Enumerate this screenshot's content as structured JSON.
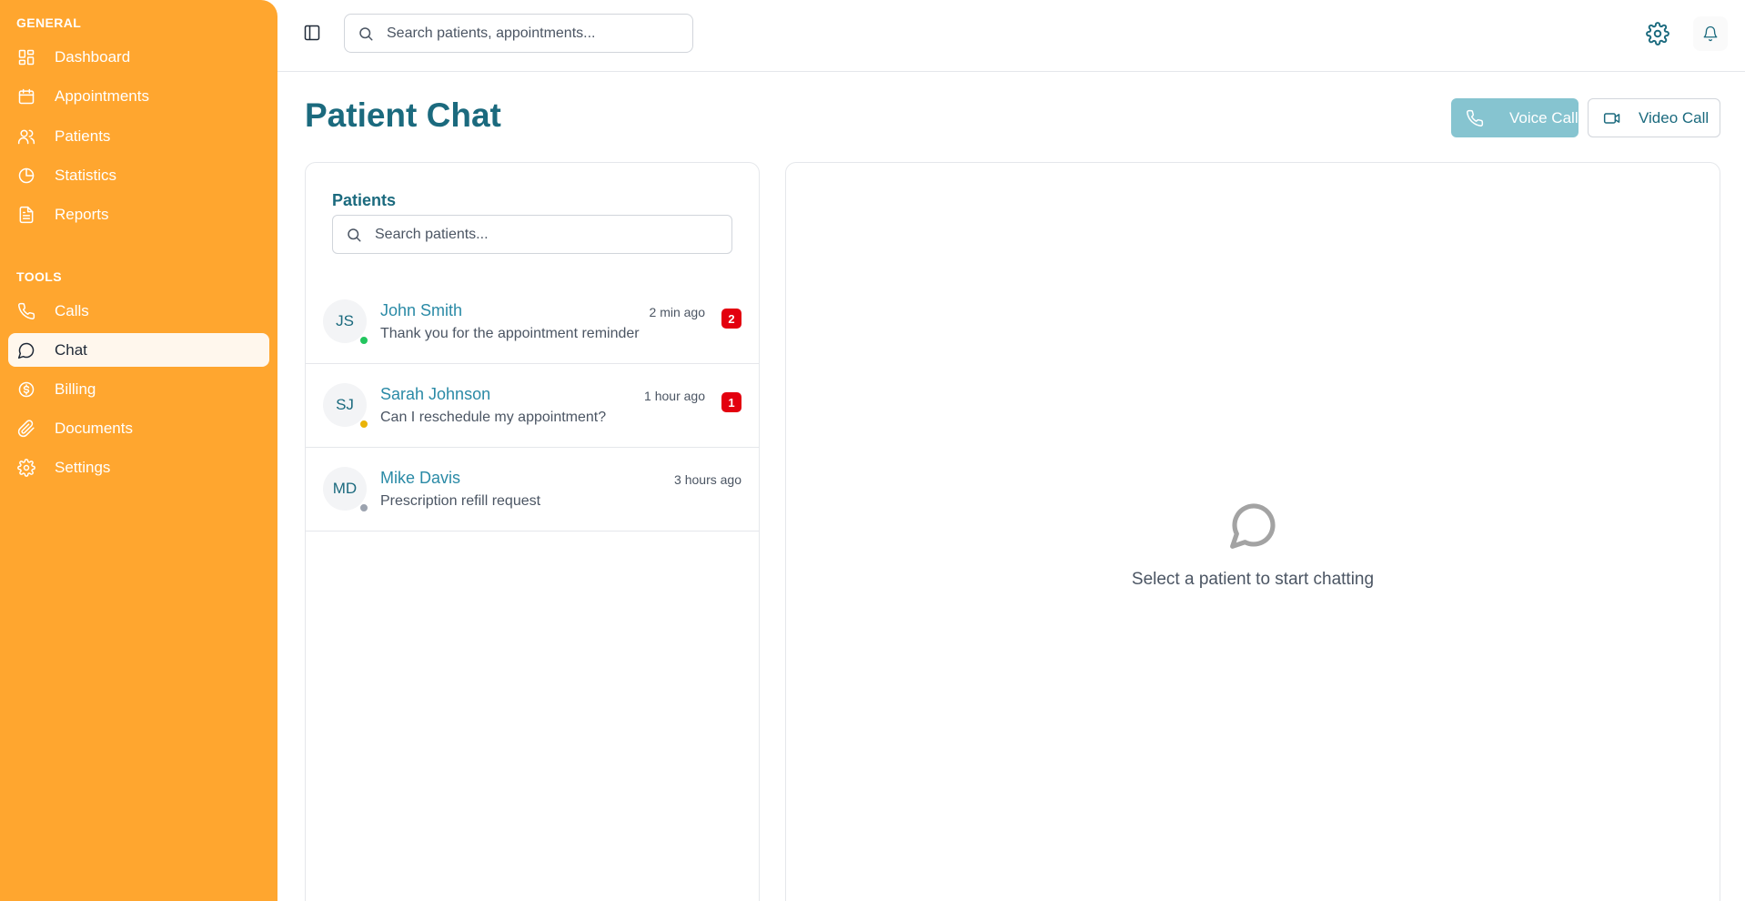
{
  "sidebar": {
    "general_label": "GENERAL",
    "tools_label": "TOOLS",
    "general_items": [
      {
        "label": "Dashboard",
        "icon": "dashboard-icon"
      },
      {
        "label": "Appointments",
        "icon": "calendar-icon"
      },
      {
        "label": "Patients",
        "icon": "users-icon"
      },
      {
        "label": "Statistics",
        "icon": "pie-chart-icon"
      },
      {
        "label": "Reports",
        "icon": "file-text-icon"
      }
    ],
    "tool_items": [
      {
        "label": "Calls",
        "icon": "phone-icon"
      },
      {
        "label": "Chat",
        "icon": "message-circle-icon",
        "active": true
      },
      {
        "label": "Billing",
        "icon": "dollar-circle-icon"
      },
      {
        "label": "Documents",
        "icon": "paperclip-icon"
      },
      {
        "label": "Settings",
        "icon": "gear-icon"
      }
    ]
  },
  "topbar": {
    "search_placeholder": "Search patients, appointments..."
  },
  "main": {
    "title": "Patient Chat",
    "voice_call_label": "Voice Call",
    "video_call_label": "Video Call"
  },
  "patients_panel": {
    "heading": "Patients",
    "search_placeholder": "Search patients...",
    "patients": [
      {
        "initials": "JS",
        "name": "John Smith",
        "time": "2 min ago",
        "message": "Thank you for the appointment reminder",
        "unread": "2",
        "status_color": "#22c55e"
      },
      {
        "initials": "SJ",
        "name": "Sarah Johnson",
        "time": "1 hour ago",
        "message": "Can I reschedule my appointment?",
        "unread": "1",
        "status_color": "#eab308"
      },
      {
        "initials": "MD",
        "name": "Mike Davis",
        "time": "3 hours ago",
        "message": "Prescription refill request",
        "unread": null,
        "status_color": "#9ca3af"
      }
    ]
  },
  "chat_panel": {
    "empty_text": "Select a patient to start chatting"
  },
  "colors": {
    "sidebar_bg": "#ffa62f",
    "primary": "#1b6a7e",
    "link": "#2a8aa6",
    "voice_button_bg": "#86c4d0",
    "badge_bg": "#e3000f"
  }
}
